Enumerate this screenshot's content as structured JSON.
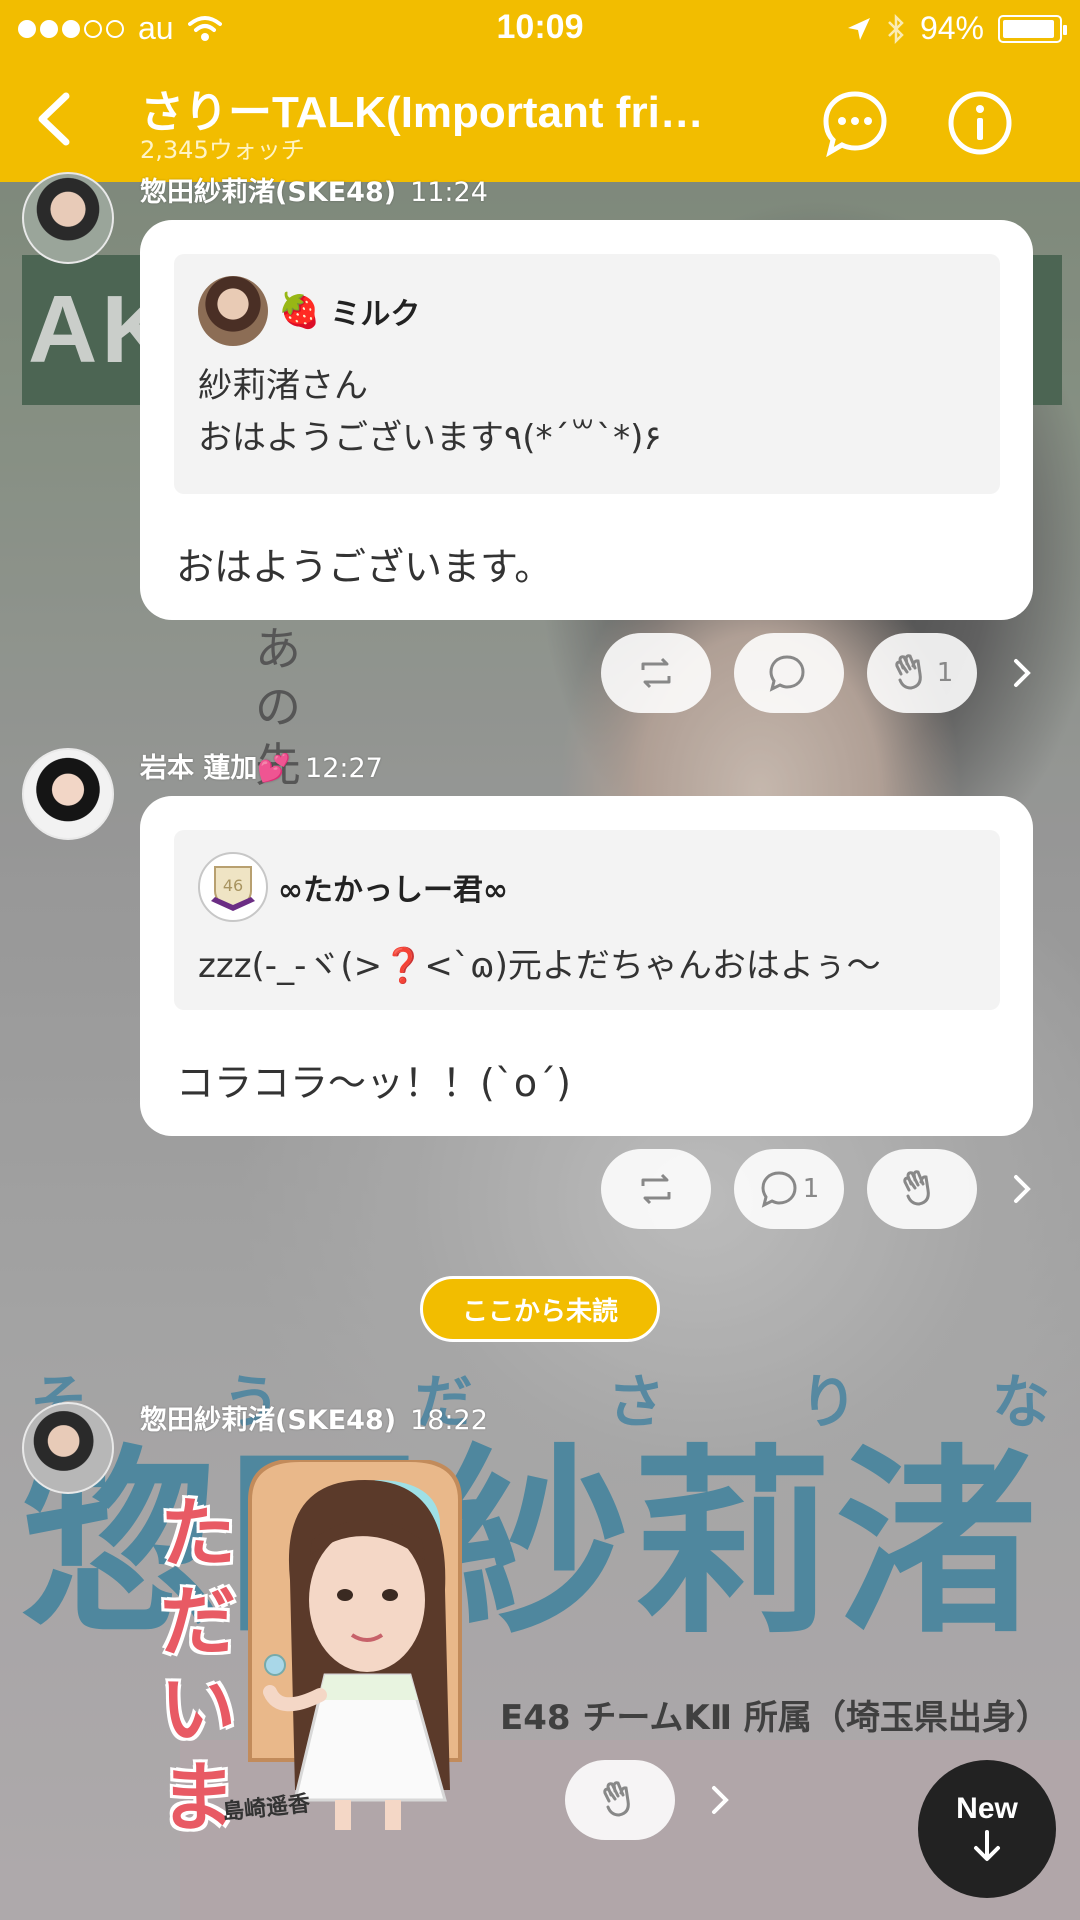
{
  "status_bar": {
    "carrier": "au",
    "time": "10:09",
    "battery": "94%",
    "battery_level": 0.94
  },
  "header": {
    "title": "さりーTALK(Important fri…",
    "watch_count": "2,345ウォッチ"
  },
  "background": {
    "sign_text": "AKB",
    "vertical_text": "あの先の",
    "banner_small": [
      "そ",
      "う",
      "だ",
      "さ",
      "り",
      "な"
    ],
    "banner_big": "惣田紗莉渚",
    "banner_sub": "E48 チームKⅡ 所属（埼玉県出身）"
  },
  "messages": [
    {
      "sender": "惣田紗莉渚(SKE48)",
      "time": "11:24",
      "quote": {
        "author": "ミルク",
        "author_emoji": "🍓",
        "text": "紗莉渚さん\nおはようございます٩(*´꒳`*)۶"
      },
      "text": "おはようございます。",
      "comment_count": "",
      "clap_count": "1"
    },
    {
      "sender": "岩本 蓮加💕",
      "time": "12:27",
      "quote": {
        "author": "∞たかっしー君∞",
        "emblem": "46",
        "text": "zzz(-_-ヾ(>❓<`ɷ)元よだちゃんおはよぅ〜"
      },
      "text": "コラコラ〜ッ！！(`o´)",
      "comment_count": "1",
      "clap_count": ""
    },
    {
      "sender": "惣田紗莉渚(SKE48)",
      "time": "18:22",
      "sticker": {
        "vertical_text": "ただいま",
        "caption": "島崎遥香"
      }
    }
  ],
  "unread_label": "ここから未読",
  "new_button": {
    "label": "New"
  },
  "colors": {
    "accent": "#f2bd00",
    "bubble": "#ffffff",
    "quote_bg": "#f3f3f3",
    "new_button_bg": "#222222"
  }
}
